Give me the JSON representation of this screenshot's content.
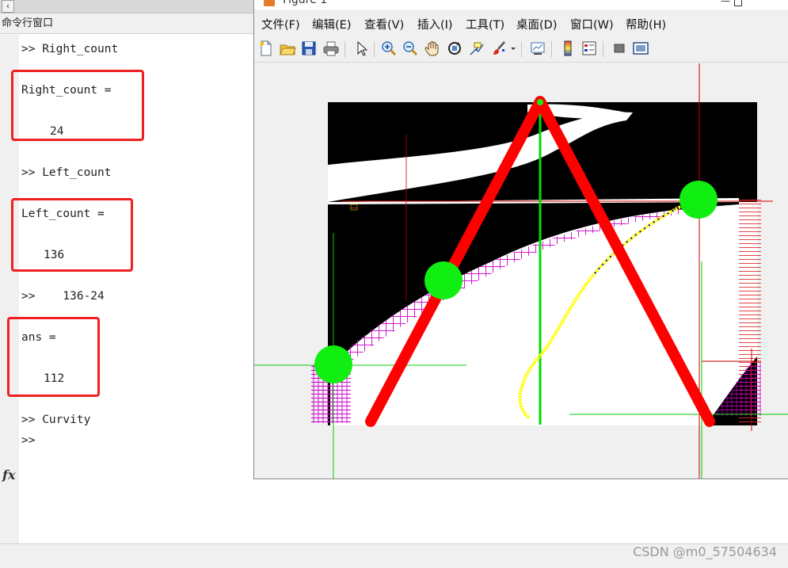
{
  "command_window": {
    "title": "命令行窗口",
    "lines": [
      ">> Right_count",
      "Right_count =",
      "24",
      ">> Left_count",
      "Left_count =",
      "136",
      ">>    136-24",
      "ans =",
      "112",
      ">> Curvity",
      ">>"
    ],
    "highlight_color": "#ef2020"
  },
  "figure_window": {
    "title": "Figure 1",
    "menu": [
      "文件(F)",
      "编辑(E)",
      "查看(V)",
      "插入(I)",
      "工具(T)",
      "桌面(D)",
      "窗口(W)",
      "帮助(H)"
    ],
    "toolbar": [
      "new-figure-icon",
      "open-file-icon",
      "save-icon",
      "print-icon",
      "select-arrow-icon",
      "zoom-in-icon",
      "zoom-out-icon",
      "pan-hand-icon",
      "rotate-3d-icon",
      "data-cursor-icon",
      "brush-icon",
      "link-plot-icon",
      "colorbar-icon",
      "legend-icon",
      "hide-plot-tools-icon",
      "show-plot-tools-icon"
    ],
    "colors": {
      "triangle": "#ff0000",
      "dots": "#00dd00",
      "crosshair_red": "#cc0000",
      "crosshair_green": "#00cc00",
      "hatch": "#cc00cc",
      "curve_yellow": "#ffff00",
      "curve_blue": "#0000cc"
    }
  },
  "watermark": "CSDN @m0_57504634"
}
